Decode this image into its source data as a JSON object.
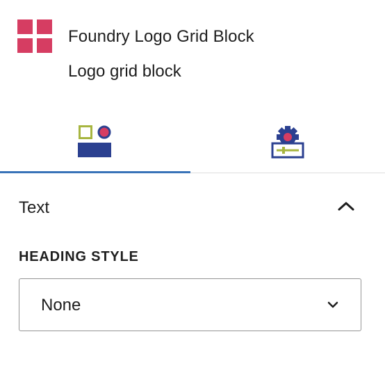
{
  "block": {
    "title": "Foundry Logo Grid Block",
    "description": "Logo grid block",
    "icon": "grid-squares-icon",
    "icon_color": "#d63d62"
  },
  "tabs": [
    {
      "name": "styles",
      "icon": "styles-shapes-icon",
      "active": true
    },
    {
      "name": "settings",
      "icon": "settings-gear-icon",
      "active": false
    }
  ],
  "colors": {
    "accent": "#3873b8",
    "icon_navy": "#2b4090",
    "icon_olive": "#a7b540",
    "icon_pink": "#d63d62",
    "text": "#1e1e1e",
    "border": "#949494"
  },
  "panel": {
    "title": "Text",
    "expanded": true,
    "toggle_icon": "chevron-up-icon",
    "field_label": "HEADING STYLE",
    "select": {
      "value": "None",
      "icon": "chevron-down-icon"
    }
  }
}
